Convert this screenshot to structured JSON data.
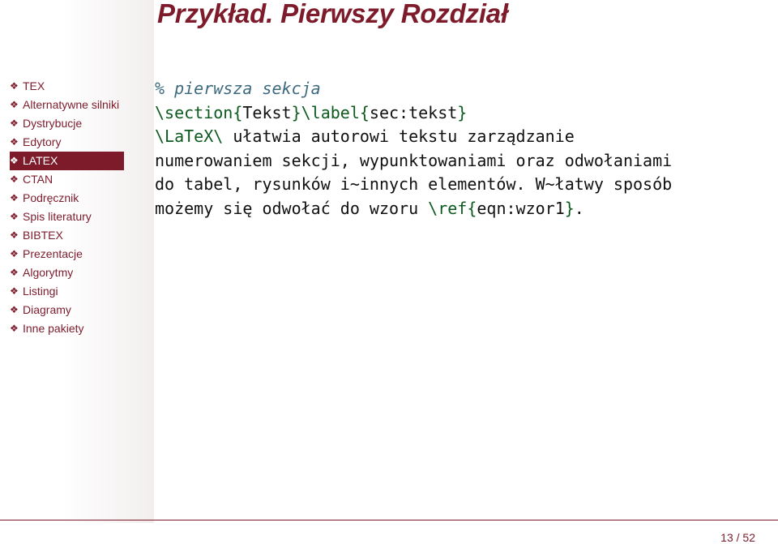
{
  "slide": {
    "title": "Przykład. Pierwszy Rozdział"
  },
  "sidebar": {
    "bullet": "❖",
    "items": [
      {
        "label": "TEX",
        "active": false
      },
      {
        "label": "Alternatywne silniki",
        "active": false
      },
      {
        "label": "Dystrybucje",
        "active": false
      },
      {
        "label": "Edytory",
        "active": false
      },
      {
        "label": "LATEX",
        "active": true
      },
      {
        "label": "CTAN",
        "active": false
      },
      {
        "label": "Podręcznik",
        "active": false
      },
      {
        "label": "Spis literatury",
        "active": false
      },
      {
        "label": "BIBTEX",
        "active": false
      },
      {
        "label": "Prezentacje",
        "active": false
      },
      {
        "label": "Algorytmy",
        "active": false
      },
      {
        "label": "Listingi",
        "active": false
      },
      {
        "label": "Diagramy",
        "active": false
      },
      {
        "label": "Inne pakiety",
        "active": false
      }
    ]
  },
  "code": {
    "comment": "% pierwsza sekcja",
    "line2": {
      "cmd1": "\\section{",
      "arg1": "Tekst",
      "cmd2": "}\\label{",
      "arg2": "sec:tekst",
      "cmd3": "}"
    },
    "line3": {
      "cmd": "\\LaTeX\\",
      "text": " ułatwia autorowi tekstu zarządzanie"
    },
    "line4": "numerowaniem sekcji, wypunktowaniami oraz odwołaniami",
    "line5": "do tabel, rysunków i~innych elementów. W~łatwy sposób",
    "line6": {
      "text": "możemy się odwołać do wzoru ",
      "cmd1": "\\ref{",
      "arg": "eqn:wzor1",
      "cmd2": "}",
      "end": "."
    }
  },
  "footer": {
    "page": "13 / 52"
  },
  "colors": {
    "accent": "#7d1b2b",
    "comment": "#3d6a7f",
    "keyword": "#0d5a1e"
  }
}
